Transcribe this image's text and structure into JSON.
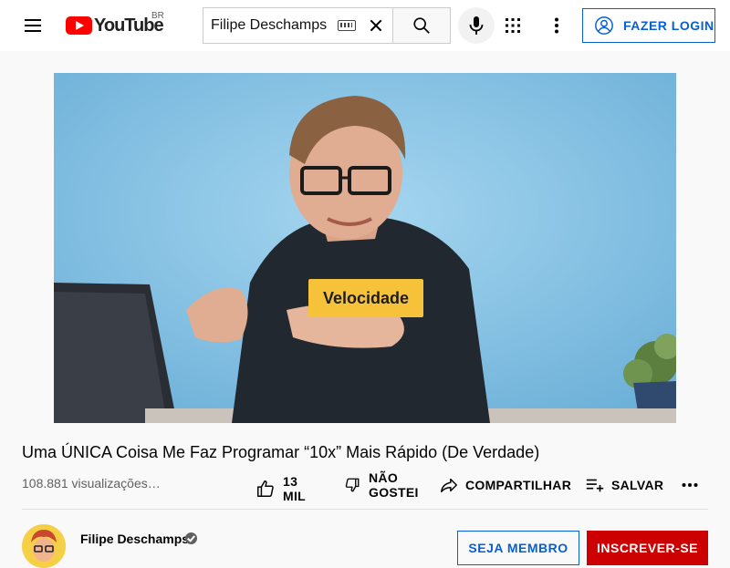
{
  "header": {
    "logo_text": "YouTube",
    "logo_country": "BR",
    "search_value": "Filipe Deschamps",
    "login_label": "FAZER LOGIN"
  },
  "player": {
    "caption": "Velocidade"
  },
  "video": {
    "title": "Uma ÚNICA Coisa Me Faz Programar “10x” Mais Rápido (De Verdade)",
    "views": "108.881 visualizações…"
  },
  "actions": {
    "like_count": "13 MIL",
    "dislike_line1": "NÃO",
    "dislike_line2": "GOSTEI",
    "share_label": "COMPARTILHAR",
    "save_label": "SALVAR"
  },
  "channel": {
    "name": "Filipe Deschamps",
    "member_label": "SEJA MEMBRO",
    "subscribe_label": "INSCREVER-SE"
  },
  "icons": {
    "menu": "hamburger-icon",
    "logo": "youtube-play-icon",
    "keyboard": "keyboard-icon",
    "clear": "close-icon",
    "search": "search-icon",
    "mic": "microphone-icon",
    "apps": "apps-grid-icon",
    "more": "more-vertical-icon",
    "account": "account-circle-icon",
    "like": "thumbs-up-icon",
    "dislike": "thumbs-down-icon",
    "share": "share-icon",
    "save": "playlist-add-icon",
    "more_actions": "more-horizontal-icon",
    "verified": "verified-check-icon"
  },
  "colors": {
    "brand_red": "#ff0000",
    "link_blue": "#065fd4",
    "subscribe_red": "#cc0000",
    "caption_yellow": "#f6c23a"
  }
}
